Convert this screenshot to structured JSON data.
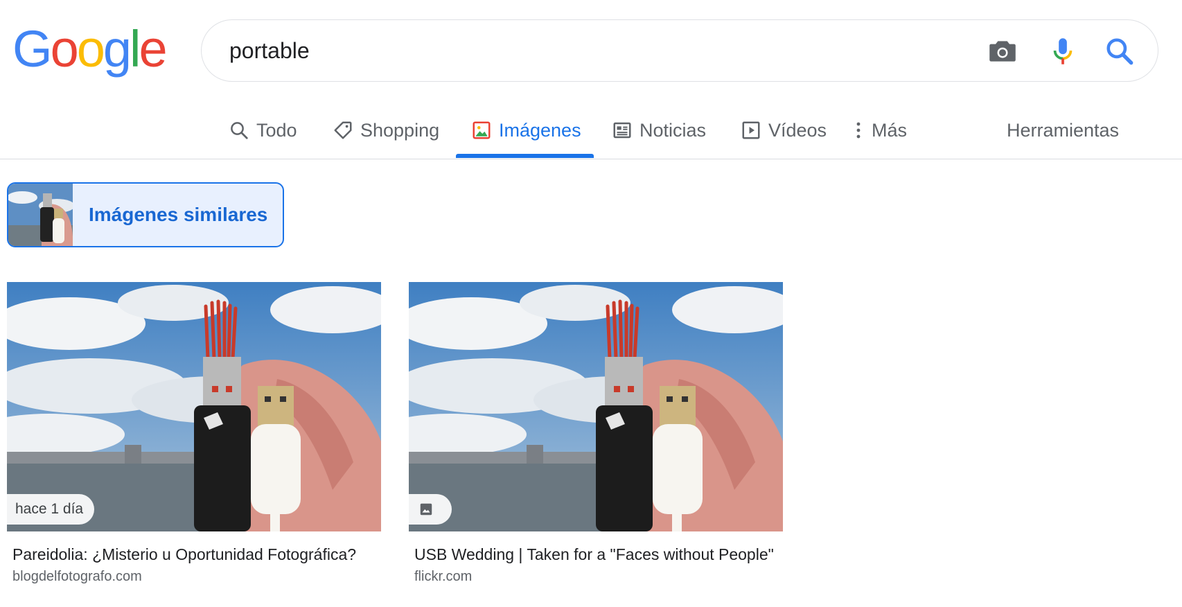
{
  "logo": {
    "text": "Google",
    "letters": [
      "G",
      "o",
      "o",
      "g",
      "l",
      "e"
    ],
    "colors": [
      "#4285F4",
      "#EA4335",
      "#FBBC05",
      "#4285F4",
      "#34A853",
      "#EA4335"
    ]
  },
  "search": {
    "query": "portable",
    "icons": [
      "camera-icon",
      "mic-icon",
      "search-icon"
    ]
  },
  "tabs": [
    {
      "label": "Todo",
      "icon": "search-icon",
      "active": false
    },
    {
      "label": "Shopping",
      "icon": "tag-icon",
      "active": false
    },
    {
      "label": "Imágenes",
      "icon": "image-icon",
      "active": true
    },
    {
      "label": "Noticias",
      "icon": "news-icon",
      "active": false
    },
    {
      "label": "Vídeos",
      "icon": "play-icon",
      "active": false
    },
    {
      "label": "Más",
      "icon": "more-vert-icon",
      "active": false
    }
  ],
  "tools_label": "Herramientas",
  "similar_images": {
    "label": "Imágenes similares"
  },
  "results": [
    {
      "title": "Pareidolia: ¿Misterio u Oportunidad Fotográfica?",
      "source": "blogdelfotografo.com",
      "badge": "hace 1 día"
    },
    {
      "title": "USB Wedding | Taken for a \"Faces without People\"",
      "source": "flickr.com",
      "badge_icon": "image-icon"
    }
  ],
  "colors": {
    "accent": "#1a73e8",
    "chip_bg": "#e8f0fe",
    "muted": "#5f6368"
  }
}
